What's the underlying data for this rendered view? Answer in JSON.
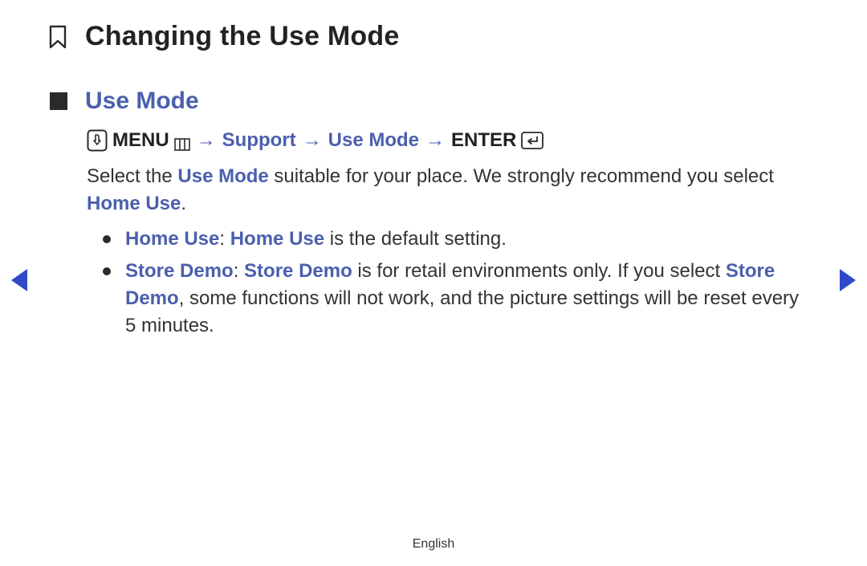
{
  "title": "Changing the Use Mode",
  "section": "Use Mode",
  "breadcrumb": {
    "menu_label": "MENU",
    "support": "Support",
    "use_mode": "Use Mode",
    "enter_label": "ENTER",
    "arrow": "→"
  },
  "intro": {
    "t1": "Select the ",
    "kw1": "Use Mode",
    "t2": " suitable for your place. We strongly recommend you select ",
    "kw2": "Home Use",
    "t3": "."
  },
  "bullets": {
    "home": {
      "kw_label": "Home Use",
      "sep": ": ",
      "kw_inline": "Home Use",
      "rest": " is the default setting."
    },
    "store": {
      "kw_label": "Store Demo",
      "sep": ": ",
      "kw_inline": "Store Demo",
      "mid1": " is for retail environments only. If you select ",
      "kw_inline2": "Store Demo",
      "mid2": ", some functions will not work, and the picture settings will be reset every 5 minutes."
    }
  },
  "footer": "English"
}
